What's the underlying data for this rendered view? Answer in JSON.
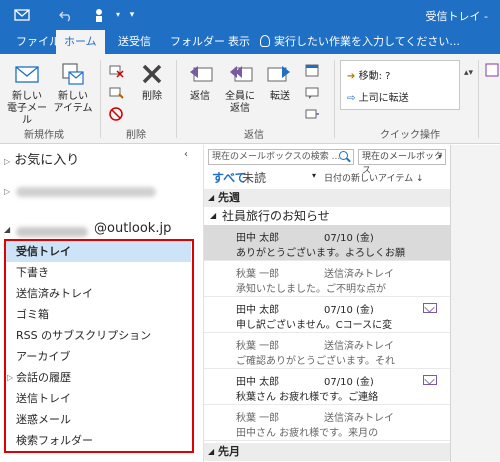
{
  "window": {
    "title": "受信トレイ - "
  },
  "tabs": [
    {
      "label": "ファイル"
    },
    {
      "label": "ホーム"
    },
    {
      "label": "送受信"
    },
    {
      "label": "フォルダー"
    },
    {
      "label": "表示"
    }
  ],
  "tell_me": "実行したい作業を入力してください...",
  "ribbon": {
    "new_email": "新しい\n電子メール",
    "new_items": "新しい\nアイテム",
    "delete": "削除",
    "reply": "返信",
    "reply_all": "全員に\n返信",
    "forward": "転送",
    "group_new": "新規作成",
    "group_delete": "削除",
    "group_respond": "返信",
    "group_quicksteps": "クイック操作",
    "qs_move": "移動: ?",
    "qs_manager": "上司に転送"
  },
  "left": {
    "favorites": "お気に入り",
    "account": "@outlook.jp",
    "folders": [
      {
        "label": "受信トレイ",
        "selected": true
      },
      {
        "label": "下書き"
      },
      {
        "label": "送信済みトレイ"
      },
      {
        "label": "ゴミ箱"
      },
      {
        "label": "RSS のサブスクリプション"
      },
      {
        "label": "アーカイブ"
      },
      {
        "label": "会話の履歴",
        "has_children": true
      },
      {
        "label": "送信トレイ"
      },
      {
        "label": "迷惑メール"
      },
      {
        "label": "検索フォルダー"
      }
    ]
  },
  "mail_list": {
    "search_placeholder": "現在のメールボックスの検索 ...",
    "scope": "現在のメールボックス",
    "filter_all": "すべて",
    "filter_unread": "未読",
    "sort": "日付の新しいアイテム ↓",
    "group_last_week": "先週",
    "thread_subject": "社員旅行のお知らせ",
    "items": [
      {
        "sender": "田中 太郎",
        "date": "07/10 (金)",
        "snippet": "ありがとうございます。よろしくお願",
        "selected": true
      },
      {
        "sender": "秋葉 一郎",
        "folder": "送信済みトレイ",
        "snippet": "承知いたしました。ご不明な点が",
        "sub": true
      },
      {
        "sender": "田中 太郎",
        "date": "07/10 (金)",
        "snippet": "申し訳ございません。Cコースに変",
        "icon": "reply-envelope-icon"
      },
      {
        "sender": "秋葉 一郎",
        "folder": "送信済みトレイ",
        "snippet": "ご確認ありがとうございます。それ",
        "sub": true
      },
      {
        "sender": "田中 太郎",
        "date": "07/10 (金)",
        "snippet": "秋葉さん お疲れ様です。ご連絡",
        "icon": "reply-envelope-icon"
      },
      {
        "sender": "秋葉 一郎",
        "folder": "送信済みトレイ",
        "snippet": "田中さん お疲れ様です。来月の",
        "sub": true
      }
    ],
    "group_last_month": "先月"
  },
  "colors": {
    "accent": "#1f6fc5",
    "highlight_border": "#e00000",
    "selected_folder": "#cde3f7"
  }
}
